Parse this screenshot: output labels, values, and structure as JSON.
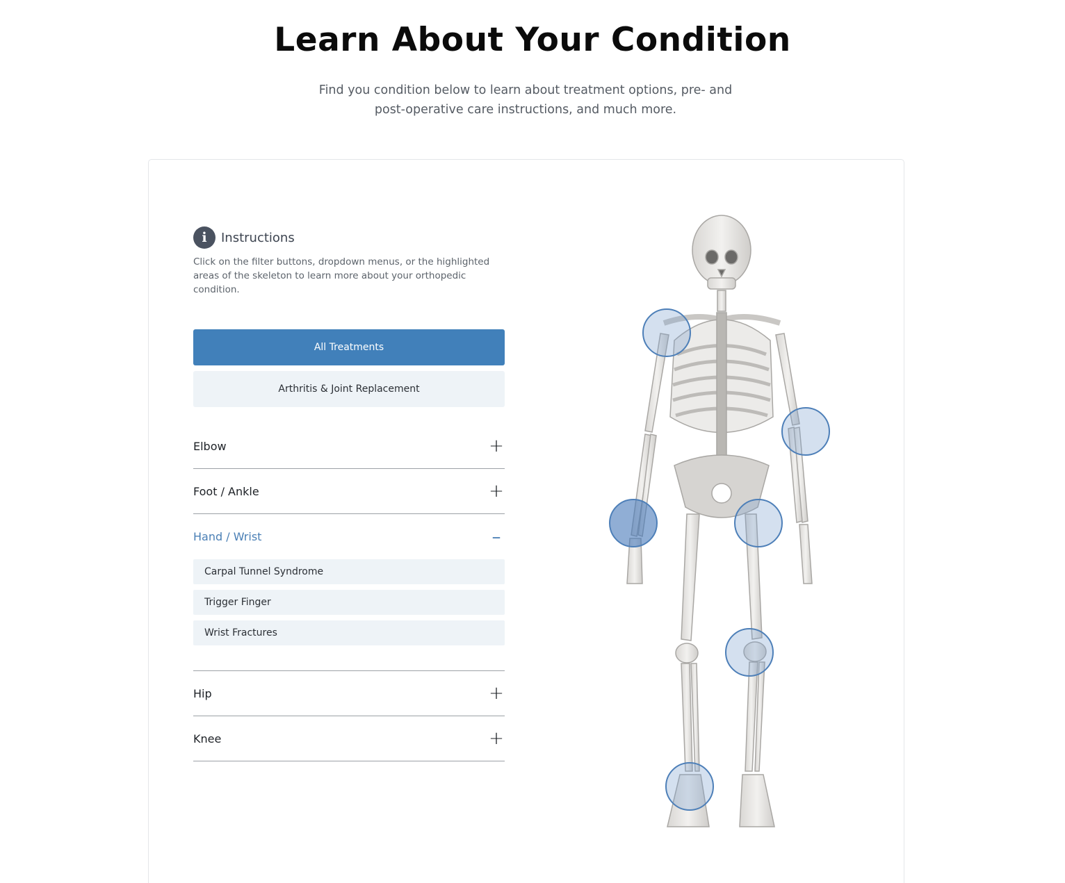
{
  "header": {
    "title": "Learn About Your Condition",
    "subtitle": "Find you condition below to learn about treatment options, pre- and post-operative care instructions, and much more."
  },
  "instructions": {
    "icon": "info-icon",
    "title": "Instructions",
    "text": "Click on the filter buttons, dropdown menus, or the highlighted areas of the skeleton to learn more about your orthopedic condition."
  },
  "filters": {
    "all": "All Treatments",
    "arthritis": "Arthritis & Joint Replacement",
    "active": "All Treatments"
  },
  "accordion": [
    {
      "label": "Elbow",
      "open": false
    },
    {
      "label": "Foot / Ankle",
      "open": false
    },
    {
      "label": "Hand / Wrist",
      "open": true,
      "items": [
        "Carpal Tunnel Syndrome",
        "Trigger Finger",
        "Wrist Fractures"
      ]
    },
    {
      "label": "Hip",
      "open": false
    },
    {
      "label": "Knee",
      "open": false
    }
  ],
  "skeleton": {
    "hotspots": [
      "shoulder",
      "elbow",
      "hand-wrist",
      "hip",
      "knee",
      "foot-ankle"
    ],
    "active_hotspot": "hand-wrist"
  },
  "colors": {
    "accent": "#4180ba",
    "accent_text": "#4a7fb5",
    "button_light": "#eef3f7",
    "divider": "#9ca1a6"
  }
}
